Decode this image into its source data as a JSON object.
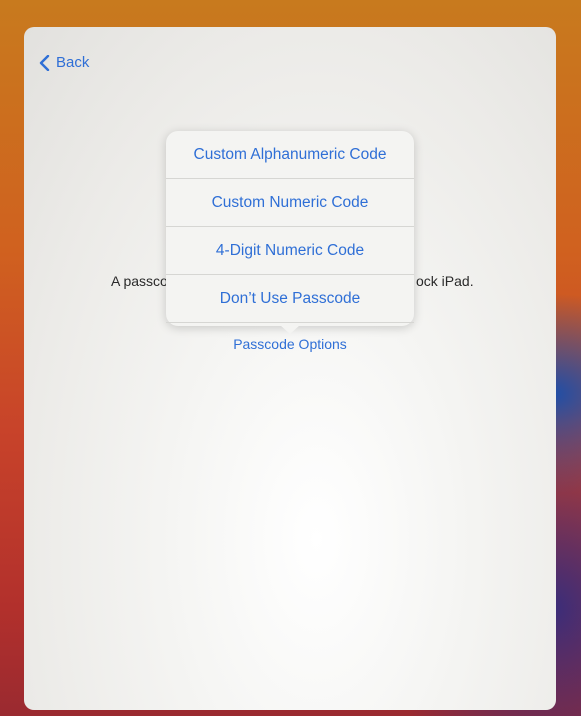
{
  "nav": {
    "back_label": "Back",
    "back_icon": "chevron-left-icon"
  },
  "description": {
    "left_fragment": "A passco",
    "right_fragment": "ock iPad."
  },
  "passcode_menu": {
    "items": [
      {
        "label": "Custom Alphanumeric Code"
      },
      {
        "label": "Custom Numeric Code"
      },
      {
        "label": "4-Digit Numeric Code"
      },
      {
        "label": "Don’t Use Passcode"
      }
    ]
  },
  "options_link": {
    "label": "Passcode Options"
  },
  "colors": {
    "accent": "#2f6fd6",
    "text": "#2a2a2a",
    "popover_bg": "#f4f4f2"
  }
}
